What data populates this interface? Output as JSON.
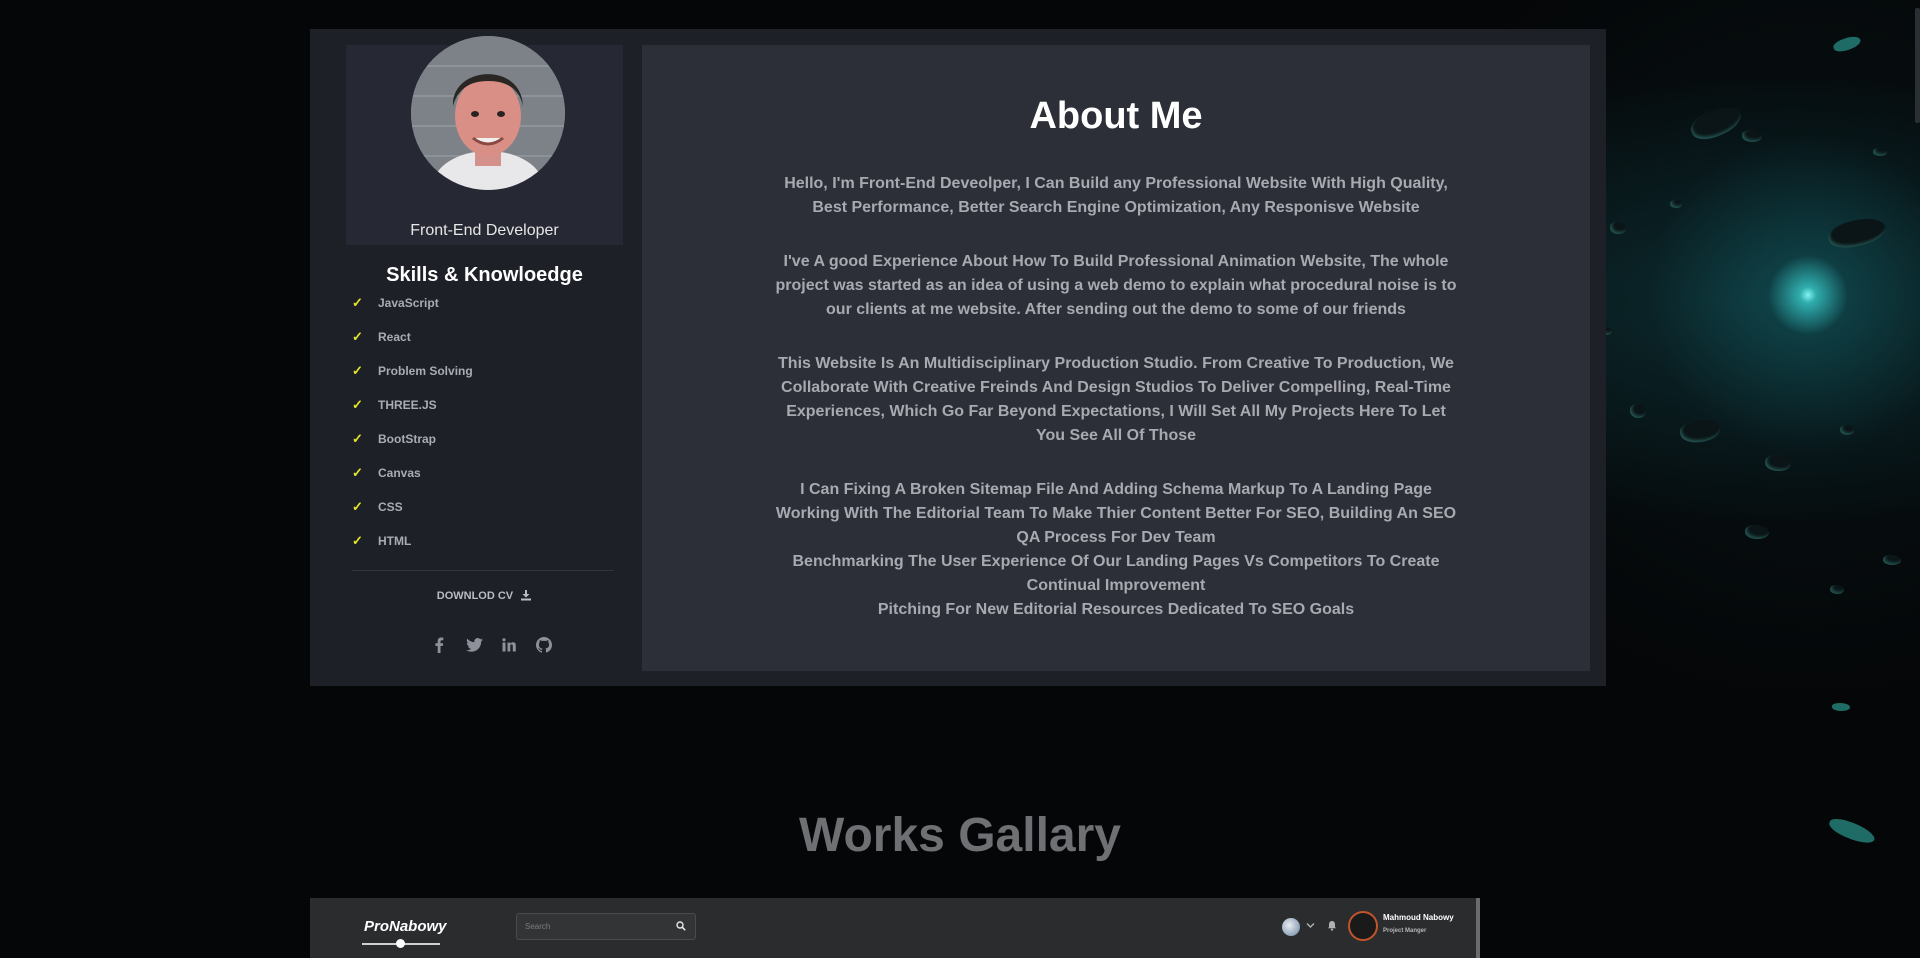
{
  "profile": {
    "role": "Front-End Developer",
    "avatar_icon": "profile-photo"
  },
  "skills": {
    "title": "Skills & Knowloedge",
    "items": [
      "JavaScript",
      "React",
      "Problem Solving",
      "THREE.JS",
      "BootStrap",
      "Canvas",
      "CSS",
      "HTML"
    ],
    "check_color": "#e4e62a"
  },
  "download": {
    "label": "DOWNLOD CV"
  },
  "socials": [
    "facebook-icon",
    "twitter-icon",
    "linkedin-icon",
    "github-icon"
  ],
  "about": {
    "title": "About Me",
    "paragraphs": [
      "Hello, I'm Front-End Deveolper, I Can Build any Professional Website With High Quality, Best Performance, Better Search Engine Optimization, Any Responisve Website",
      "I've A good Experience About How To Build Professional Animation Website, The whole project was started as an idea of using a web demo to explain what procedural noise is to our clients at me website. After sending out the demo to some of our friends",
      "This Website Is An Multidisciplinary Production Studio. From Creative To Production, We Collaborate With Creative Freinds And Design Studios To Deliver Compelling, Real-Time Experiences, Which Go Far Beyond Expectations, I Will Set All My Projects Here To Let You See All Of Those",
      "I Can Fixing A Broken Sitemap File And Adding Schema Markup To A Landing Page Working With The Editorial Team To Make Thier Content Better For SEO, Building An SEO QA Process For Dev Team",
      "Benchmarking The User Experience Of Our Landing Pages Vs Competitors To Create Continual Improvement",
      "Pitching For New Editorial Resources Dedicated To SEO Goals"
    ]
  },
  "works": {
    "title": "Works Gallary"
  },
  "gallery_preview": {
    "logo": "ProNabowy",
    "search_placeholder": "Search",
    "user_name": "Mahmoud Nabowy",
    "user_role": "Project Manger"
  },
  "colors": {
    "page_bg": "#050607",
    "card_bg": "#1e2027",
    "panel_bg": "#2c2e38",
    "glow": "#8cffff"
  }
}
